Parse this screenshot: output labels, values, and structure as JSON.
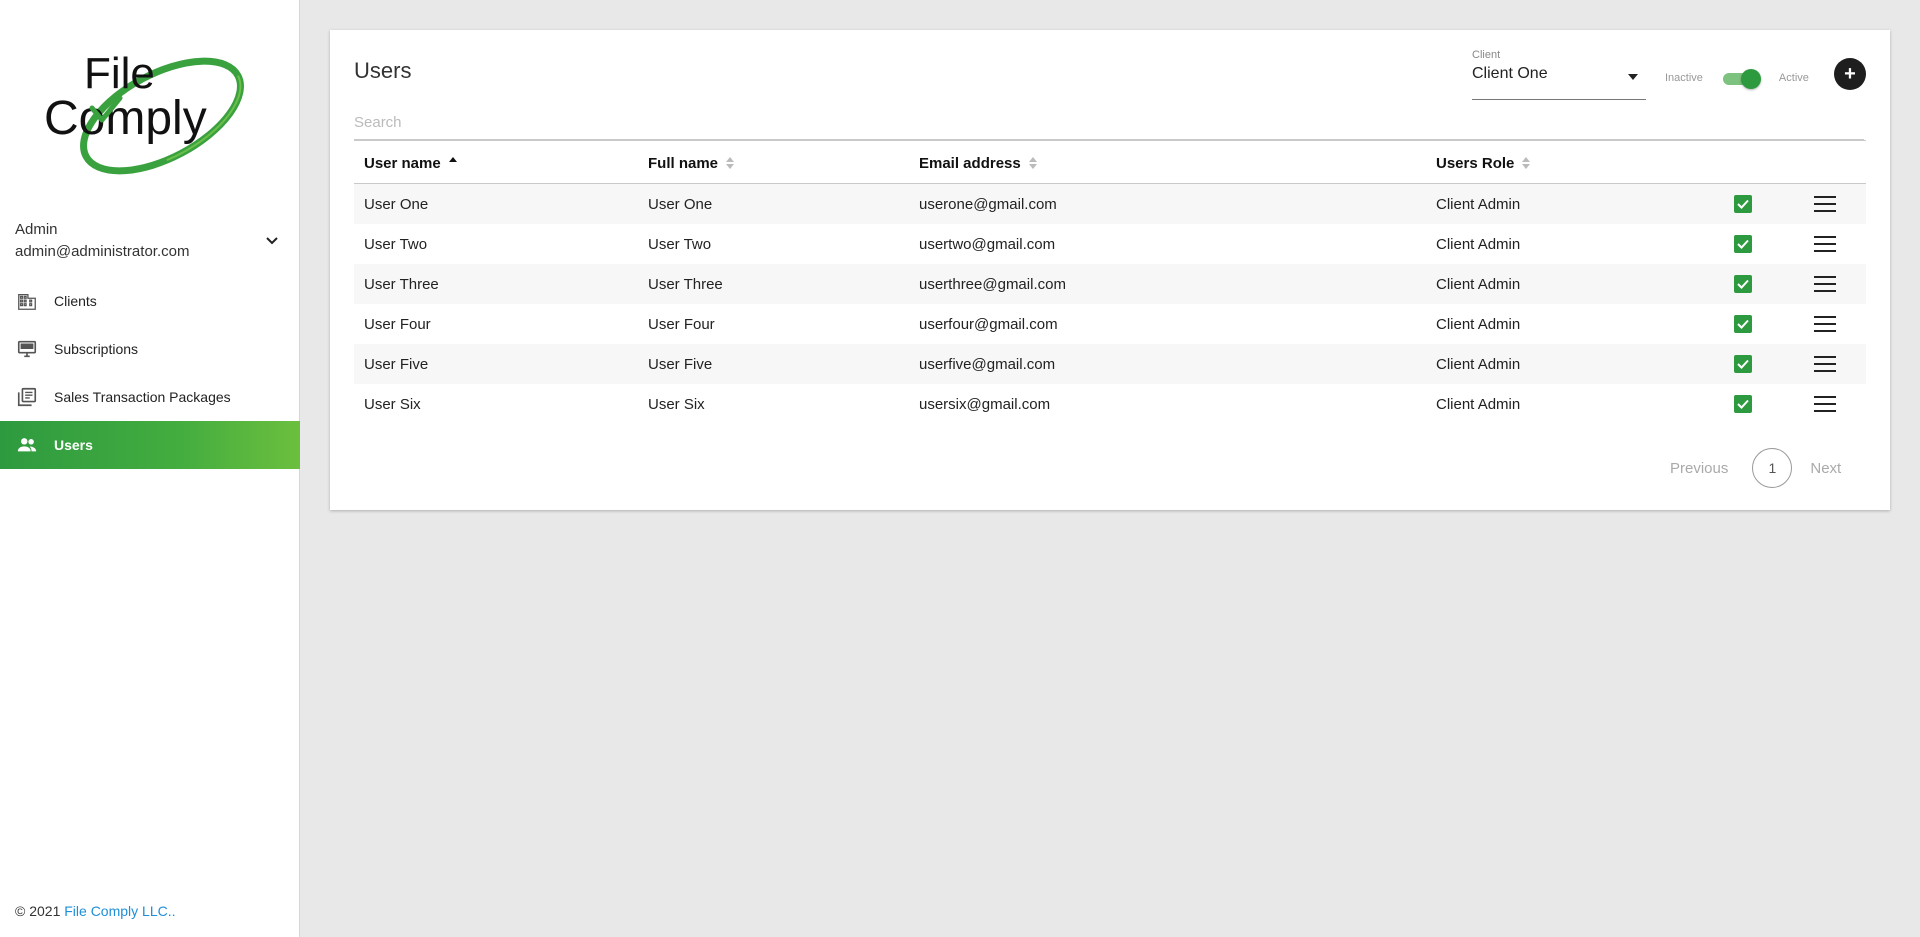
{
  "logo": {
    "line1": "File",
    "line2": "Comply"
  },
  "account": {
    "name": "Admin",
    "email": "admin@administrator.com"
  },
  "nav": [
    {
      "label": "Clients",
      "icon": "building-icon",
      "active": false
    },
    {
      "label": "Subscriptions",
      "icon": "monitor-icon",
      "active": false
    },
    {
      "label": "Sales Transaction Packages",
      "icon": "library-icon",
      "active": false
    },
    {
      "label": "Users",
      "icon": "people-icon",
      "active": true
    }
  ],
  "footer": {
    "copyright": "© 2021",
    "company": "File Comply LLC.."
  },
  "page": {
    "title": "Users",
    "search_placeholder": "Search",
    "client_label": "Client",
    "client_value": "Client One",
    "toggle_off": "Inactive",
    "toggle_on": "Active",
    "add_label": "+"
  },
  "table": {
    "columns": [
      "User name",
      "Full name",
      "Email address",
      "Users Role"
    ],
    "rows": [
      [
        "User One",
        "User One",
        "userone@gmail.com",
        "Client Admin"
      ],
      [
        "User Two",
        "User Two",
        "usertwo@gmail.com",
        "Client Admin"
      ],
      [
        "User Three",
        "User Three",
        "userthree@gmail.com",
        "Client Admin"
      ],
      [
        "User Four",
        "User Four",
        "userfour@gmail.com",
        "Client Admin"
      ],
      [
        "User Five",
        "User Five",
        "userfive@gmail.com",
        "Client Admin"
      ],
      [
        "User Six",
        "User Six",
        "usersix@gmail.com",
        "Client Admin"
      ]
    ]
  },
  "pagination": {
    "previous": "Previous",
    "current": "1",
    "next": "Next"
  },
  "colors": {
    "accent": "#2e9a3f",
    "link": "#1e8fd8"
  }
}
